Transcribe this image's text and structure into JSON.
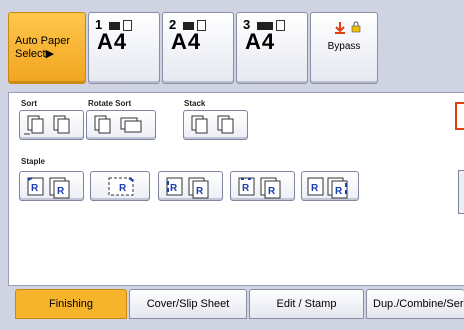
{
  "paper": {
    "auto_paper_select": "Auto Paper\nSelect▶",
    "trays": [
      {
        "number": "1",
        "size": "A4"
      },
      {
        "number": "2",
        "size": "A4"
      },
      {
        "number": "3",
        "size": "A4"
      }
    ],
    "bypass_label": "Bypass"
  },
  "finishing": {
    "sort_label": "Sort",
    "rotate_sort_label": "Rotate Sort",
    "stack_label": "Stack",
    "staple_label": "Staple"
  },
  "tabs": [
    {
      "label": "Finishing",
      "active": true
    },
    {
      "label": "Cover/Slip Sheet"
    },
    {
      "label": "Edit / Stamp"
    },
    {
      "label": "Dup./Combine/Series"
    }
  ],
  "colors": {
    "active_tab": "#f6b42c",
    "auto_select": "#f6b42c",
    "accent_red": "#e04010"
  }
}
